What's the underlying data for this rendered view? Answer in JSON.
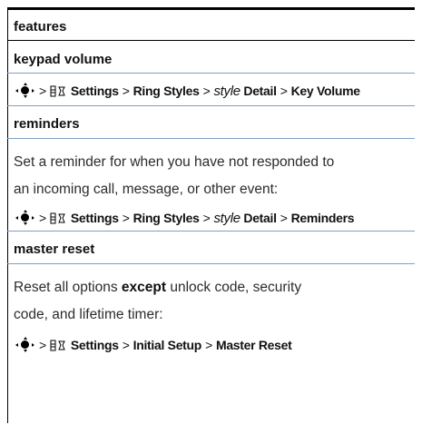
{
  "sections": {
    "title": "features",
    "keypad": {
      "heading": "keypad volume",
      "path": {
        "sep": ">",
        "settings": "Settings",
        "ring_styles": "Ring Styles",
        "style_word": "style",
        "detail": "Detail",
        "target": "Key Volume"
      }
    },
    "reminders": {
      "heading": "reminders",
      "line1": "Set a reminder for when you have not responded to",
      "line2": "an incoming call, message, or other event:",
      "path": {
        "sep": ">",
        "settings": "Settings",
        "ring_styles": "Ring Styles",
        "style_word": "style",
        "detail": "Detail",
        "target": "Reminders"
      }
    },
    "master_reset": {
      "heading": "master reset",
      "line1_pre": "Reset all options ",
      "line1_bold": "except",
      "line1_post": " unlock code, security",
      "line2": "code, and lifetime timer:",
      "path": {
        "sep": ">",
        "settings": "Settings",
        "initial_setup": "Initial Setup",
        "target": "Master Reset"
      }
    }
  },
  "colors": {
    "rule_blue": "#7da0c2",
    "rule_black": "#000000"
  }
}
